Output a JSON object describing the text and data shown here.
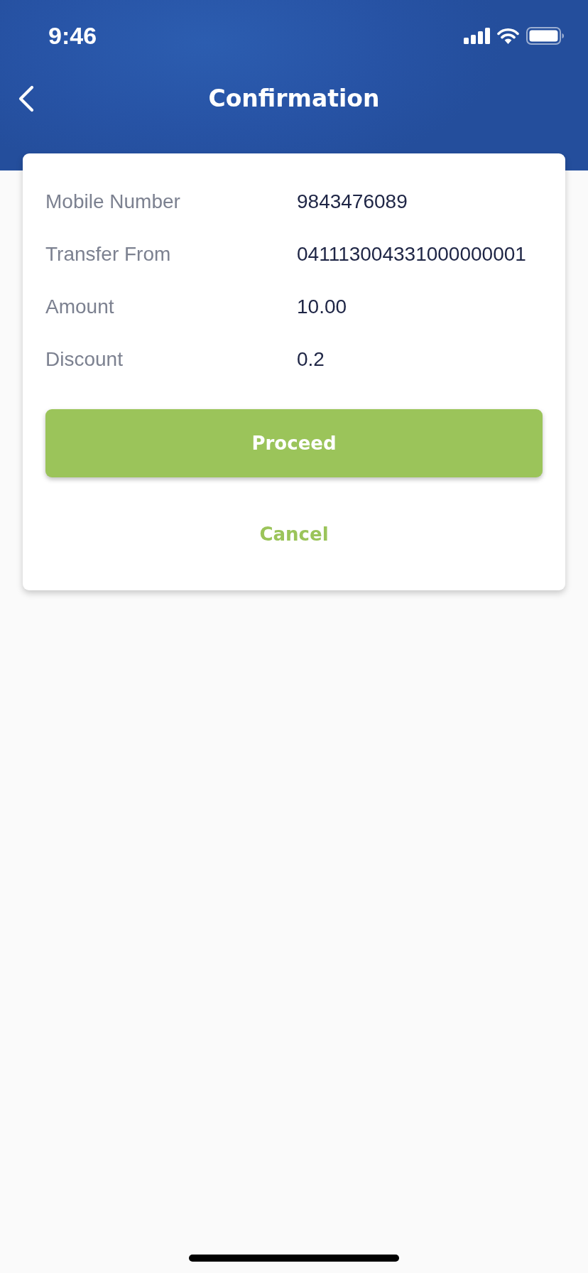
{
  "status_bar": {
    "time": "9:46"
  },
  "header": {
    "title": "Confirmation"
  },
  "details": [
    {
      "label": "Mobile Number",
      "value": "9843476089"
    },
    {
      "label": "Transfer From",
      "value": "041113004331000000001"
    },
    {
      "label": "Amount",
      "value": "10.00"
    },
    {
      "label": "Discount",
      "value": "0.2"
    }
  ],
  "buttons": [
    {
      "kind": "filled",
      "label": "Proceed"
    },
    {
      "kind": "text",
      "label": "Cancel"
    }
  ]
}
